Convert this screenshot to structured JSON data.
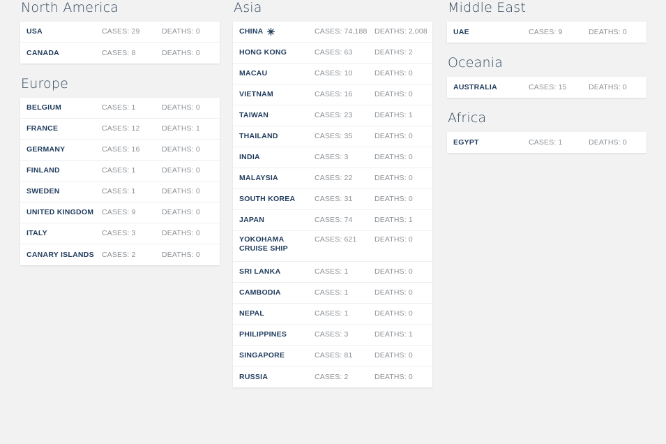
{
  "page": {
    "background_color": "#f2f2f2",
    "card_color": "#ffffff",
    "heading_color": "#32475e",
    "country_color": "#1f3b5c",
    "metric_color": "#8a8f94"
  },
  "columns": [
    {
      "name": "column-left",
      "regions": [
        {
          "title": "North America",
          "rows": [
            {
              "country": "USA",
              "icon": null,
              "cases": "CASES: 29",
              "deaths": "DEATHS: 0"
            },
            {
              "country": "CANADA",
              "icon": null,
              "cases": "CASES: 8",
              "deaths": "DEATHS: 0"
            }
          ]
        },
        {
          "title": "Europe",
          "rows": [
            {
              "country": "BELGIUM",
              "icon": null,
              "cases": "CASES: 1",
              "deaths": "DEATHS: 0"
            },
            {
              "country": "FRANCE",
              "icon": null,
              "cases": "CASES: 12",
              "deaths": "DEATHS: 1"
            },
            {
              "country": "GERMANY",
              "icon": null,
              "cases": "CASES: 16",
              "deaths": "DEATHS: 0"
            },
            {
              "country": "FINLAND",
              "icon": null,
              "cases": "CASES: 1",
              "deaths": "DEATHS: 0"
            },
            {
              "country": "SWEDEN",
              "icon": null,
              "cases": "CASES: 1",
              "deaths": "DEATHS: 0"
            },
            {
              "country": "UNITED KINGDOM",
              "icon": null,
              "cases": "CASES: 9",
              "deaths": "DEATHS: 0"
            },
            {
              "country": "ITALY",
              "icon": null,
              "cases": "CASES: 3",
              "deaths": "DEATHS: 0"
            },
            {
              "country": "CANARY ISLANDS",
              "icon": null,
              "cases": "CASES: 2",
              "deaths": "DEATHS: 0"
            }
          ]
        }
      ]
    },
    {
      "name": "column-center",
      "regions": [
        {
          "title": "Asia",
          "rows": [
            {
              "country": "CHINA",
              "icon": "virus-origin-icon",
              "cases": "CASES: 74,188",
              "deaths": "DEATHS: 2,008"
            },
            {
              "country": "HONG KONG",
              "icon": null,
              "cases": "CASES: 63",
              "deaths": "DEATHS: 2"
            },
            {
              "country": "MACAU",
              "icon": null,
              "cases": "CASES: 10",
              "deaths": "DEATHS: 0"
            },
            {
              "country": "VIETNAM",
              "icon": null,
              "cases": "CASES: 16",
              "deaths": "DEATHS: 0"
            },
            {
              "country": "TAIWAN",
              "icon": null,
              "cases": "CASES: 23",
              "deaths": "DEATHS: 1"
            },
            {
              "country": "THAILAND",
              "icon": null,
              "cases": "CASES: 35",
              "deaths": "DEATHS: 0"
            },
            {
              "country": "INDIA",
              "icon": null,
              "cases": "CASES: 3",
              "deaths": "DEATHS: 0"
            },
            {
              "country": "MALAYSIA",
              "icon": null,
              "cases": "CASES: 22",
              "deaths": "DEATHS: 0"
            },
            {
              "country": "SOUTH KOREA",
              "icon": null,
              "cases": "CASES: 31",
              "deaths": "DEATHS: 0"
            },
            {
              "country": "JAPAN",
              "icon": null,
              "cases": "CASES: 74",
              "deaths": "DEATHS: 1"
            },
            {
              "country": "YOKOHAMA\nCRUISE SHIP",
              "icon": null,
              "cases": "CASES: 621",
              "deaths": "DEATHS: 0",
              "tall": true
            },
            {
              "country": "SRI LANKA",
              "icon": null,
              "cases": "CASES: 1",
              "deaths": "DEATHS: 0"
            },
            {
              "country": "CAMBODIA",
              "icon": null,
              "cases": "CASES: 1",
              "deaths": "DEATHS: 0"
            },
            {
              "country": "NEPAL",
              "icon": null,
              "cases": "CASES: 1",
              "deaths": "DEATHS: 0"
            },
            {
              "country": "PHILIPPINES",
              "icon": null,
              "cases": "CASES: 3",
              "deaths": "DEATHS: 1"
            },
            {
              "country": "SINGAPORE",
              "icon": null,
              "cases": "CASES: 81",
              "deaths": "DEATHS: 0"
            },
            {
              "country": "RUSSIA",
              "icon": null,
              "cases": "CASES: 2",
              "deaths": "DEATHS: 0"
            }
          ]
        }
      ]
    },
    {
      "name": "column-right",
      "regions": [
        {
          "title": "Middle East",
          "rows": [
            {
              "country": "UAE",
              "icon": null,
              "cases": "CASES: 9",
              "deaths": "DEATHS: 0"
            }
          ]
        },
        {
          "title": "Oceania",
          "rows": [
            {
              "country": "AUSTRALIA",
              "icon": null,
              "cases": "CASES: 15",
              "deaths": "DEATHS: 0"
            }
          ]
        },
        {
          "title": "Africa",
          "rows": [
            {
              "country": "EGYPT",
              "icon": null,
              "cases": "CASES: 1",
              "deaths": "DEATHS: 0"
            }
          ]
        }
      ]
    }
  ]
}
